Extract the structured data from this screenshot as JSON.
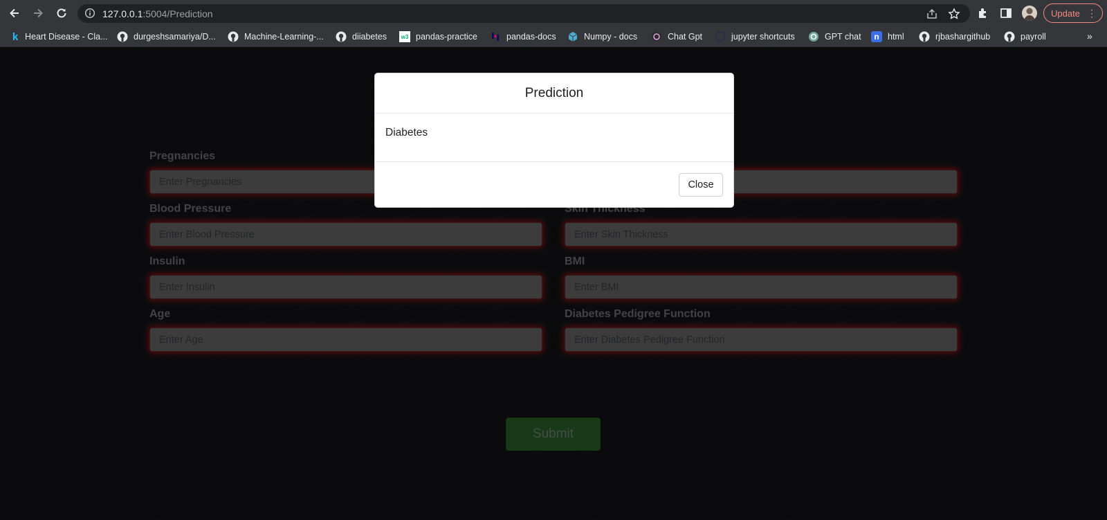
{
  "browser": {
    "url_host": "127.0.0.1",
    "url_rest": ":5004/Prediction",
    "update_label": "Update",
    "bookmarks": [
      {
        "label": "Heart Disease - Cla...",
        "icon": "kaggle-icon"
      },
      {
        "label": "durgeshsamariya/D...",
        "icon": "github-icon"
      },
      {
        "label": "Machine-Learning-...",
        "icon": "github-icon"
      },
      {
        "label": "diiabetes",
        "icon": "github-icon"
      },
      {
        "label": "pandas-practice",
        "icon": "w3schools-icon"
      },
      {
        "label": "pandas-docs",
        "icon": "pandas-icon"
      },
      {
        "label": "Numpy - docs",
        "icon": "numpy-icon"
      },
      {
        "label": "Chat Gpt",
        "icon": "openai-icon"
      },
      {
        "label": "jupyter shortcuts",
        "icon": "globe-icon"
      },
      {
        "label": "GPT chat",
        "icon": "openai-icon"
      },
      {
        "label": "html",
        "icon": "notion-icon"
      },
      {
        "label": "rjbashargithub",
        "icon": "github-icon"
      },
      {
        "label": "payroll",
        "icon": "github-icon"
      }
    ],
    "more_label": "»"
  },
  "form": {
    "fields": [
      {
        "label": "Pregnancies",
        "placeholder": "Enter Pregnancies"
      },
      {
        "label": "",
        "placeholder": ""
      },
      {
        "label": "Blood Pressure",
        "placeholder": "Enter Blood Pressure"
      },
      {
        "label": "Skin Thickness",
        "placeholder": "Enter Skin Thickness"
      },
      {
        "label": "Insulin",
        "placeholder": "Enter Insulin"
      },
      {
        "label": "BMI",
        "placeholder": "Enter BMI"
      },
      {
        "label": "Age",
        "placeholder": "Enter Age"
      },
      {
        "label": "Diabetes Pedigree Function",
        "placeholder": "Enter Diabetes Pedigree Function"
      }
    ],
    "submit_label": "Submit"
  },
  "modal": {
    "title": "Prediction",
    "result": "Diabetes",
    "close_label": "Close"
  },
  "colors": {
    "accent_update": "#f28b82",
    "submit_green": "#2f6a2f",
    "input_glow": "#c81414"
  }
}
